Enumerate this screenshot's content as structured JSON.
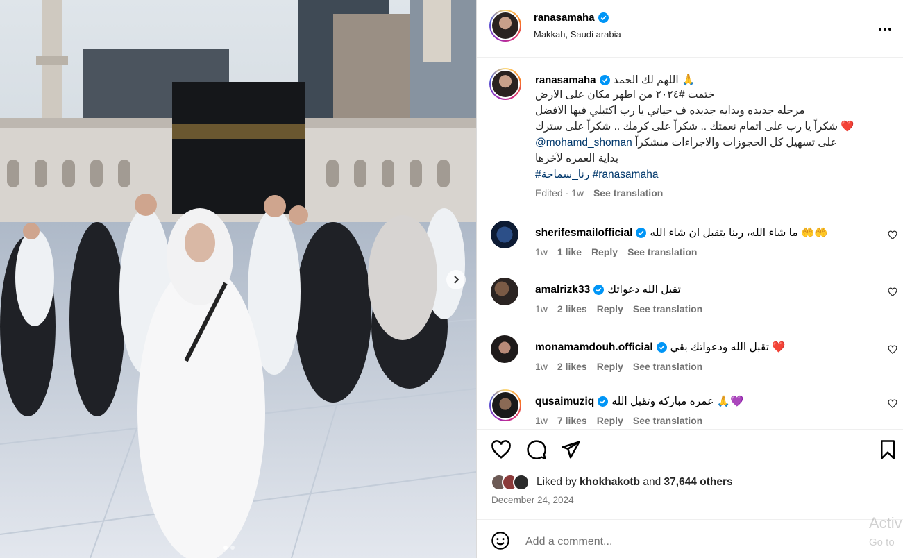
{
  "post": {
    "username": "ranasamaha",
    "location": "Makkah, Saudi arabia",
    "more_icon": "more-dots-icon",
    "carousel": {
      "slides": 2,
      "active": 1
    }
  },
  "caption": {
    "username": "ranasamaha",
    "line1": "اللهم لك الحمد 🙏",
    "line2": "ختمت #٢٠٢٤ من اطهر مكان على الارض",
    "line3": "مرحله جديده وبدايه جديده ف حياتي يا رب اكتبلي فيها الافضل",
    "line4": "شكراً يا رب على اتمام نعمتك .. شكراً على كرمك .. شكراً على سترك ❤️",
    "line5_prefix": "شكراً ",
    "line5_mention": "@mohamd_shoman",
    "line5_suffix": " على تسهيل كل الحجوزات والاجراءات من",
    "line6": "بداية العمره لآخرها",
    "hashtags": "#رنا_سماحة #ranasamaha",
    "edited": "Edited · 1w",
    "see_translation": "See translation"
  },
  "comments": [
    {
      "username": "sherifesmailofficial",
      "text": "ما شاء الله، ربنا يتقبل ان شاء الله 🤲🤲",
      "time": "1w",
      "likes": "1 like",
      "reply": "Reply",
      "see_translation": "See translation"
    },
    {
      "username": "amalrizk33",
      "text": "تقبل الله دعواتك",
      "time": "1w",
      "likes": "2 likes",
      "reply": "Reply",
      "see_translation": "See translation"
    },
    {
      "username": "monamamdouh.official",
      "text": "تقبل الله ودعواتك بقي ❤️",
      "time": "1w",
      "likes": "2 likes",
      "reply": "Reply",
      "see_translation": "See translation"
    },
    {
      "username": "qusaimuziq",
      "text": "عمره مباركه وتقبل الله 🙏💜",
      "time": "1w",
      "likes": "7 likes",
      "reply": "Reply",
      "see_translation": "See translation"
    }
  ],
  "likes": {
    "prefix": "Liked by ",
    "user": "khokhakotb",
    "middle": " and ",
    "others": "37,644 others"
  },
  "date": "December 24, 2024",
  "add_comment": {
    "placeholder": "Add a comment..."
  },
  "watermark": {
    "line1": "Activ",
    "line2": "Go to"
  },
  "colors": {
    "link": "#00376b",
    "verified": "#0095f6",
    "meta": "#737373",
    "heart_red": "#e0245e"
  }
}
